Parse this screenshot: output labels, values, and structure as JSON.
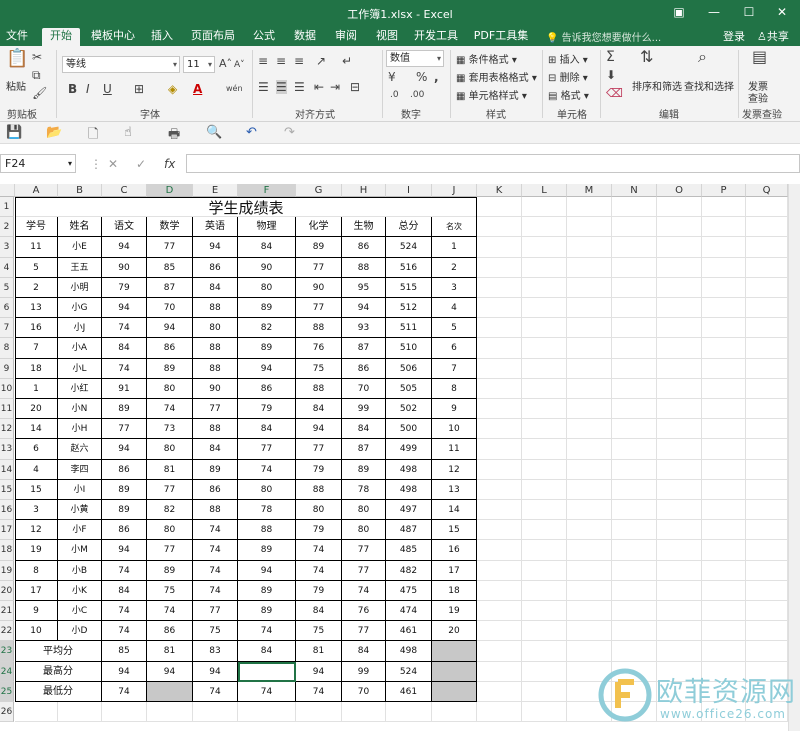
{
  "window": {
    "title": "工作簿1.xlsx - Excel"
  },
  "tabs": [
    "文件",
    "开始",
    "模板中心",
    "插入",
    "页面布局",
    "公式",
    "数据",
    "审阅",
    "视图",
    "开发工具",
    "PDF工具集"
  ],
  "active_tab": "开始",
  "tell_me": "告诉我您想要做什么...",
  "account": {
    "login": "登录",
    "share": "共享"
  },
  "ribbon": {
    "clipboard": {
      "paste": "粘贴",
      "label": "剪贴板"
    },
    "font": {
      "name": "等线",
      "size": "11",
      "label": "字体",
      "bold": "B",
      "italic": "I",
      "underline": "U",
      "grow": "A",
      "shrink": "A",
      "color_letter": "A",
      "wen": "wén"
    },
    "alignment": {
      "label": "对齐方式"
    },
    "number": {
      "format": "数值",
      "label": "数字",
      "percent": "%",
      "comma": ","
    },
    "styles": {
      "cond": "条件格式",
      "table": "套用表格格式",
      "cell": "单元格样式",
      "label": "样式"
    },
    "cells": {
      "insert": "插入",
      "delete": "删除",
      "format": "格式",
      "label": "单元格"
    },
    "editing": {
      "sort": "排序和筛选",
      "find": "查找和选择",
      "label": "编辑"
    },
    "invoice": {
      "check1": "发票",
      "check2": "查验",
      "label": "发票查验"
    }
  },
  "formula_bar": {
    "name_box": "F24",
    "fx": "fx",
    "formula": ""
  },
  "columns": [
    "A",
    "B",
    "C",
    "D",
    "E",
    "F",
    "G",
    "H",
    "I",
    "J",
    "K",
    "L",
    "M",
    "N",
    "O",
    "P",
    "Q"
  ],
  "rows": [
    "1",
    "2",
    "3",
    "4",
    "5",
    "6",
    "7",
    "8",
    "9",
    "10",
    "11",
    "12",
    "13",
    "14",
    "15",
    "16",
    "17",
    "18",
    "19",
    "20",
    "21",
    "22",
    "23",
    "24",
    "25",
    "26"
  ],
  "sheet_title": "学生成绩表",
  "headers": [
    "学号",
    "姓名",
    "语文",
    "数学",
    "英语",
    "物理",
    "化学",
    "生物",
    "总分",
    "名次"
  ],
  "students": [
    [
      "11",
      "小E",
      "94",
      "77",
      "94",
      "84",
      "89",
      "86",
      "524",
      "1"
    ],
    [
      "5",
      "王五",
      "90",
      "85",
      "86",
      "90",
      "77",
      "88",
      "516",
      "2"
    ],
    [
      "2",
      "小明",
      "79",
      "87",
      "84",
      "80",
      "90",
      "95",
      "515",
      "3"
    ],
    [
      "13",
      "小G",
      "94",
      "70",
      "88",
      "89",
      "77",
      "94",
      "512",
      "4"
    ],
    [
      "16",
      "小J",
      "74",
      "94",
      "80",
      "82",
      "88",
      "93",
      "511",
      "5"
    ],
    [
      "7",
      "小A",
      "84",
      "86",
      "88",
      "89",
      "76",
      "87",
      "510",
      "6"
    ],
    [
      "18",
      "小L",
      "74",
      "89",
      "88",
      "94",
      "75",
      "86",
      "506",
      "7"
    ],
    [
      "1",
      "小红",
      "91",
      "80",
      "90",
      "86",
      "88",
      "70",
      "505",
      "8"
    ],
    [
      "20",
      "小N",
      "89",
      "74",
      "77",
      "79",
      "84",
      "99",
      "502",
      "9"
    ],
    [
      "14",
      "小H",
      "77",
      "73",
      "88",
      "84",
      "94",
      "84",
      "500",
      "10"
    ],
    [
      "6",
      "赵六",
      "94",
      "80",
      "84",
      "77",
      "77",
      "87",
      "499",
      "11"
    ],
    [
      "4",
      "李四",
      "86",
      "81",
      "89",
      "74",
      "79",
      "89",
      "498",
      "12"
    ],
    [
      "15",
      "小I",
      "89",
      "77",
      "86",
      "80",
      "88",
      "78",
      "498",
      "13"
    ],
    [
      "3",
      "小黄",
      "89",
      "82",
      "88",
      "78",
      "80",
      "80",
      "497",
      "14"
    ],
    [
      "12",
      "小F",
      "86",
      "80",
      "74",
      "88",
      "79",
      "80",
      "487",
      "15"
    ],
    [
      "19",
      "小M",
      "94",
      "77",
      "74",
      "89",
      "74",
      "77",
      "485",
      "16"
    ],
    [
      "8",
      "小B",
      "74",
      "89",
      "74",
      "94",
      "74",
      "77",
      "482",
      "17"
    ],
    [
      "17",
      "小K",
      "84",
      "75",
      "74",
      "89",
      "79",
      "74",
      "475",
      "18"
    ],
    [
      "9",
      "小C",
      "74",
      "74",
      "77",
      "89",
      "84",
      "76",
      "474",
      "19"
    ],
    [
      "10",
      "小D",
      "74",
      "86",
      "75",
      "74",
      "75",
      "77",
      "461",
      "20"
    ]
  ],
  "summary": [
    {
      "label": "平均分",
      "values": [
        "85",
        "81",
        "83",
        "84",
        "81",
        "84",
        "498",
        ""
      ]
    },
    {
      "label": "最高分",
      "values": [
        "94",
        "94",
        "94",
        "",
        "94",
        "99",
        "524",
        ""
      ]
    },
    {
      "label": "最低分",
      "values": [
        "74",
        "",
        "74",
        "74",
        "74",
        "70",
        "461",
        ""
      ]
    }
  ],
  "watermark": {
    "brand": "欧菲资源网",
    "url": "www.office26.com"
  }
}
